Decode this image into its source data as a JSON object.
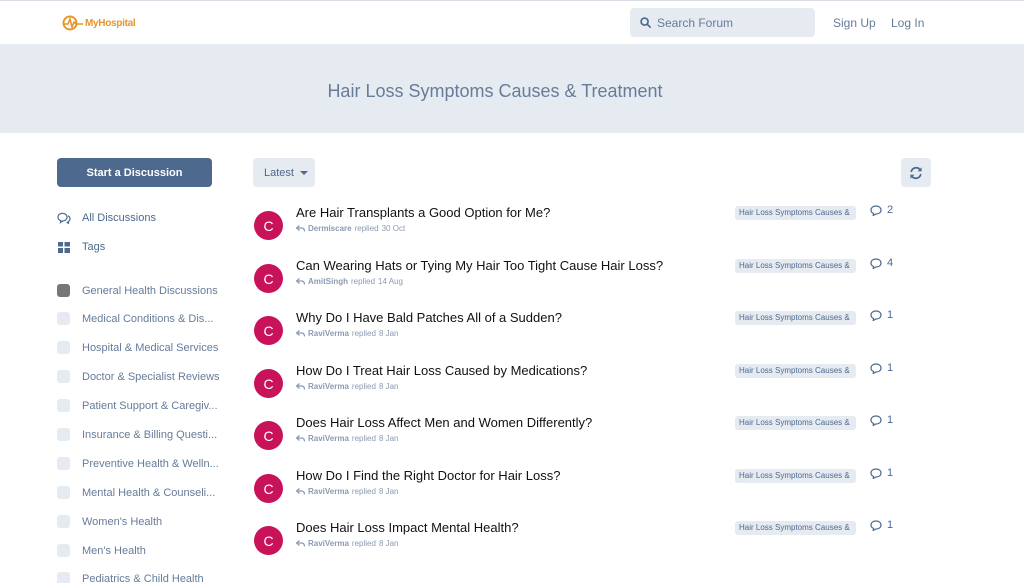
{
  "header": {
    "logo_text": "MyHospital",
    "search_placeholder": "Search Forum",
    "signup": "Sign Up",
    "login": "Log In"
  },
  "hero": {
    "title": "Hair Loss Symptoms Causes & Treatment"
  },
  "sidebar": {
    "start_label": "Start a Discussion",
    "nav": [
      {
        "label": "All Discussions",
        "icon": "comments-icon"
      },
      {
        "label": "Tags",
        "icon": "tags-grid-icon"
      }
    ],
    "tags": [
      {
        "label": "General Health Discussions",
        "color": "#777777"
      },
      {
        "label": "Medical Conditions & Dis...",
        "color": "#e6ebf2"
      },
      {
        "label": "Hospital & Medical Services",
        "color": "#e6ebf2"
      },
      {
        "label": "Doctor & Specialist Reviews",
        "color": "#e6ebf2"
      },
      {
        "label": "Patient Support & Caregiv...",
        "color": "#e6ebf2"
      },
      {
        "label": "Insurance & Billing Questi...",
        "color": "#e6ebf2"
      },
      {
        "label": "Preventive Health & Welln...",
        "color": "#e6ebf2"
      },
      {
        "label": "Mental Health & Counseli...",
        "color": "#e6ebf2"
      },
      {
        "label": "Women's Health",
        "color": "#e6ebf2"
      },
      {
        "label": "Men's Health",
        "color": "#e6ebf2"
      },
      {
        "label": "Pediatrics & Child Health",
        "color": "#e6ebf2"
      }
    ]
  },
  "toolbar": {
    "sort_label": "Latest"
  },
  "discussions": [
    {
      "avatar": "C",
      "title": "Are Hair Transplants a Good Option for Me?",
      "user": "Dermiscare",
      "verb": "replied",
      "date": "30 Oct",
      "tag": "Hair Loss Symptoms Causes &",
      "count": "2"
    },
    {
      "avatar": "C",
      "title": "Can Wearing Hats or Tying My Hair Too Tight Cause Hair Loss?",
      "user": "AmitSingh",
      "verb": "replied",
      "date": "14 Aug",
      "tag": "Hair Loss Symptoms Causes &",
      "count": "4"
    },
    {
      "avatar": "C",
      "title": "Why Do I Have Bald Patches All of a Sudden?",
      "user": "RaviVerma",
      "verb": "replied",
      "date": "8 Jan",
      "tag": "Hair Loss Symptoms Causes &",
      "count": "1"
    },
    {
      "avatar": "C",
      "title": "How Do I Treat Hair Loss Caused by Medications?",
      "user": "RaviVerma",
      "verb": "replied",
      "date": "8 Jan",
      "tag": "Hair Loss Symptoms Causes &",
      "count": "1"
    },
    {
      "avatar": "C",
      "title": "Does Hair Loss Affect Men and Women Differently?",
      "user": "RaviVerma",
      "verb": "replied",
      "date": "8 Jan",
      "tag": "Hair Loss Symptoms Causes &",
      "count": "1"
    },
    {
      "avatar": "C",
      "title": "How Do I Find the Right Doctor for Hair Loss?",
      "user": "RaviVerma",
      "verb": "replied",
      "date": "8 Jan",
      "tag": "Hair Loss Symptoms Causes &",
      "count": "1"
    },
    {
      "avatar": "C",
      "title": "Does Hair Loss Impact Mental Health?",
      "user": "RaviVerma",
      "verb": "replied",
      "date": "8 Jan",
      "tag": "Hair Loss Symptoms Causes &",
      "count": "1"
    }
  ]
}
